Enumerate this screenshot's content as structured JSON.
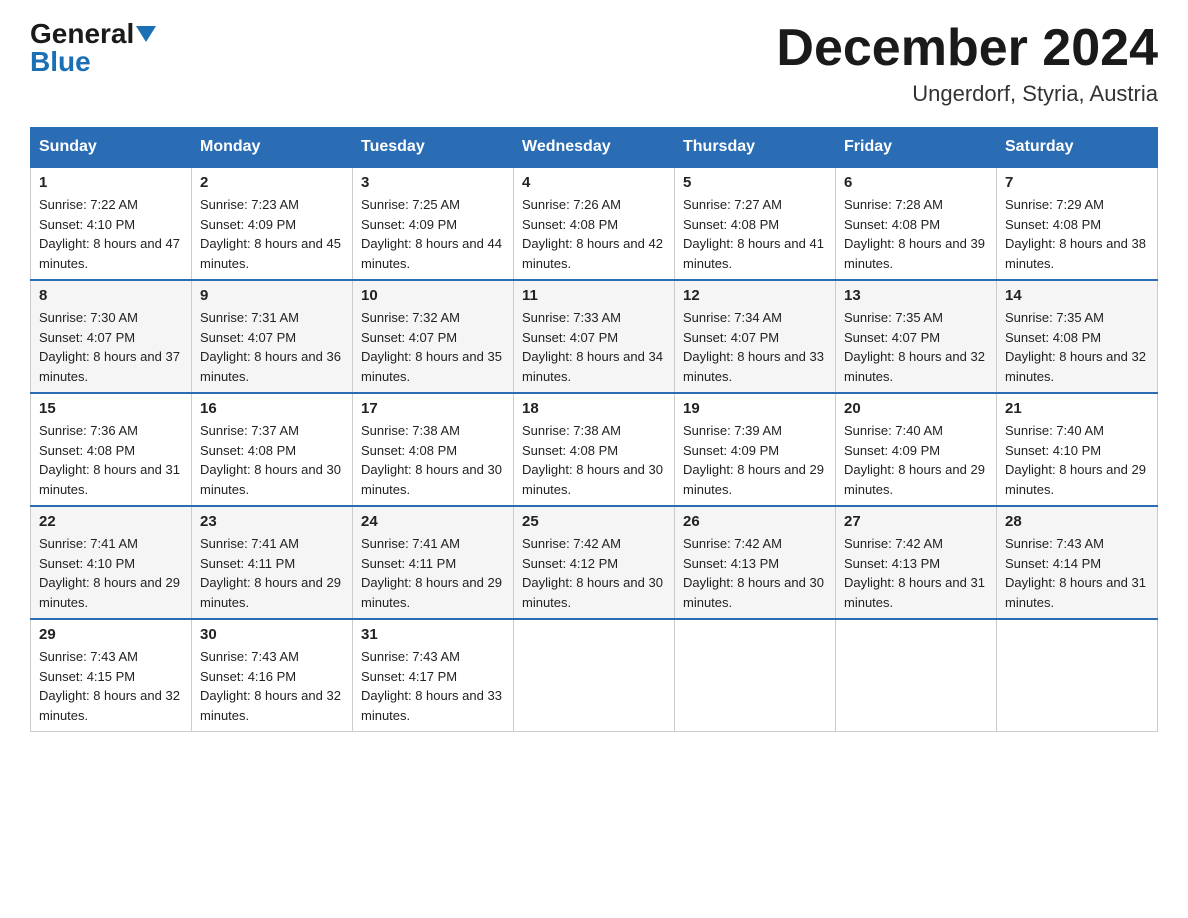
{
  "header": {
    "logo_general": "General",
    "logo_blue": "Blue",
    "month_title": "December 2024",
    "location": "Ungerdorf, Styria, Austria"
  },
  "days_of_week": [
    "Sunday",
    "Monday",
    "Tuesday",
    "Wednesday",
    "Thursday",
    "Friday",
    "Saturday"
  ],
  "weeks": [
    [
      {
        "day": "1",
        "sunrise": "7:22 AM",
        "sunset": "4:10 PM",
        "daylight": "8 hours and 47 minutes."
      },
      {
        "day": "2",
        "sunrise": "7:23 AM",
        "sunset": "4:09 PM",
        "daylight": "8 hours and 45 minutes."
      },
      {
        "day": "3",
        "sunrise": "7:25 AM",
        "sunset": "4:09 PM",
        "daylight": "8 hours and 44 minutes."
      },
      {
        "day": "4",
        "sunrise": "7:26 AM",
        "sunset": "4:08 PM",
        "daylight": "8 hours and 42 minutes."
      },
      {
        "day": "5",
        "sunrise": "7:27 AM",
        "sunset": "4:08 PM",
        "daylight": "8 hours and 41 minutes."
      },
      {
        "day": "6",
        "sunrise": "7:28 AM",
        "sunset": "4:08 PM",
        "daylight": "8 hours and 39 minutes."
      },
      {
        "day": "7",
        "sunrise": "7:29 AM",
        "sunset": "4:08 PM",
        "daylight": "8 hours and 38 minutes."
      }
    ],
    [
      {
        "day": "8",
        "sunrise": "7:30 AM",
        "sunset": "4:07 PM",
        "daylight": "8 hours and 37 minutes."
      },
      {
        "day": "9",
        "sunrise": "7:31 AM",
        "sunset": "4:07 PM",
        "daylight": "8 hours and 36 minutes."
      },
      {
        "day": "10",
        "sunrise": "7:32 AM",
        "sunset": "4:07 PM",
        "daylight": "8 hours and 35 minutes."
      },
      {
        "day": "11",
        "sunrise": "7:33 AM",
        "sunset": "4:07 PM",
        "daylight": "8 hours and 34 minutes."
      },
      {
        "day": "12",
        "sunrise": "7:34 AM",
        "sunset": "4:07 PM",
        "daylight": "8 hours and 33 minutes."
      },
      {
        "day": "13",
        "sunrise": "7:35 AM",
        "sunset": "4:07 PM",
        "daylight": "8 hours and 32 minutes."
      },
      {
        "day": "14",
        "sunrise": "7:35 AM",
        "sunset": "4:08 PM",
        "daylight": "8 hours and 32 minutes."
      }
    ],
    [
      {
        "day": "15",
        "sunrise": "7:36 AM",
        "sunset": "4:08 PM",
        "daylight": "8 hours and 31 minutes."
      },
      {
        "day": "16",
        "sunrise": "7:37 AM",
        "sunset": "4:08 PM",
        "daylight": "8 hours and 30 minutes."
      },
      {
        "day": "17",
        "sunrise": "7:38 AM",
        "sunset": "4:08 PM",
        "daylight": "8 hours and 30 minutes."
      },
      {
        "day": "18",
        "sunrise": "7:38 AM",
        "sunset": "4:08 PM",
        "daylight": "8 hours and 30 minutes."
      },
      {
        "day": "19",
        "sunrise": "7:39 AM",
        "sunset": "4:09 PM",
        "daylight": "8 hours and 29 minutes."
      },
      {
        "day": "20",
        "sunrise": "7:40 AM",
        "sunset": "4:09 PM",
        "daylight": "8 hours and 29 minutes."
      },
      {
        "day": "21",
        "sunrise": "7:40 AM",
        "sunset": "4:10 PM",
        "daylight": "8 hours and 29 minutes."
      }
    ],
    [
      {
        "day": "22",
        "sunrise": "7:41 AM",
        "sunset": "4:10 PM",
        "daylight": "8 hours and 29 minutes."
      },
      {
        "day": "23",
        "sunrise": "7:41 AM",
        "sunset": "4:11 PM",
        "daylight": "8 hours and 29 minutes."
      },
      {
        "day": "24",
        "sunrise": "7:41 AM",
        "sunset": "4:11 PM",
        "daylight": "8 hours and 29 minutes."
      },
      {
        "day": "25",
        "sunrise": "7:42 AM",
        "sunset": "4:12 PM",
        "daylight": "8 hours and 30 minutes."
      },
      {
        "day": "26",
        "sunrise": "7:42 AM",
        "sunset": "4:13 PM",
        "daylight": "8 hours and 30 minutes."
      },
      {
        "day": "27",
        "sunrise": "7:42 AM",
        "sunset": "4:13 PM",
        "daylight": "8 hours and 31 minutes."
      },
      {
        "day": "28",
        "sunrise": "7:43 AM",
        "sunset": "4:14 PM",
        "daylight": "8 hours and 31 minutes."
      }
    ],
    [
      {
        "day": "29",
        "sunrise": "7:43 AM",
        "sunset": "4:15 PM",
        "daylight": "8 hours and 32 minutes."
      },
      {
        "day": "30",
        "sunrise": "7:43 AM",
        "sunset": "4:16 PM",
        "daylight": "8 hours and 32 minutes."
      },
      {
        "day": "31",
        "sunrise": "7:43 AM",
        "sunset": "4:17 PM",
        "daylight": "8 hours and 33 minutes."
      },
      null,
      null,
      null,
      null
    ]
  ]
}
